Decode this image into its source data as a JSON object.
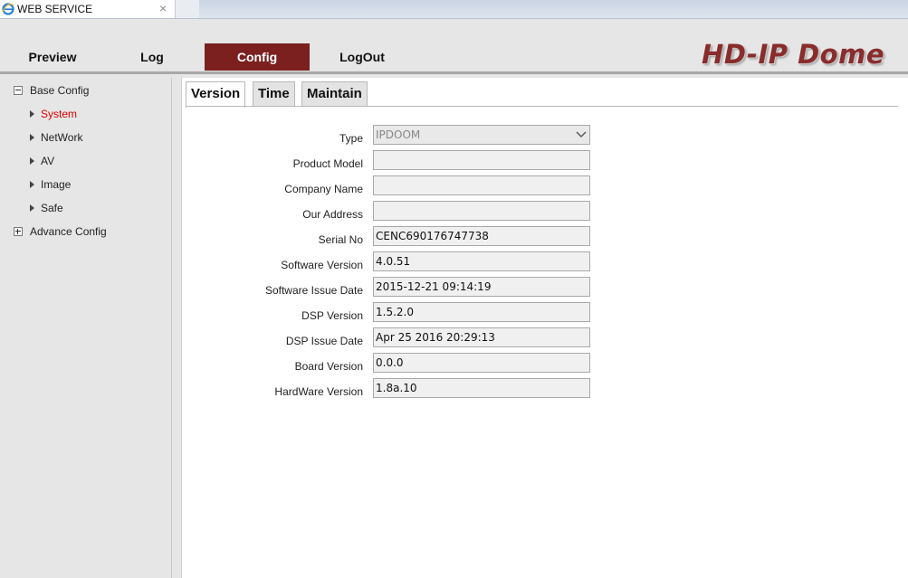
{
  "browser": {
    "tab_title": "WEB SERVICE",
    "close_symbol": "×",
    "icon": "ie-icon"
  },
  "header": {
    "nav": [
      "Preview",
      "Log",
      "Config",
      "LogOut"
    ],
    "active_nav": "Config",
    "brand": "HD-IP Dome",
    "colors": {
      "active_nav_bg": "#7b1f1f",
      "brand": "#8a2c2c"
    }
  },
  "sidebar": {
    "groups": [
      {
        "label": "Base Config",
        "expanded": true,
        "toggle": "−"
      },
      {
        "label": "Advance Config",
        "expanded": false,
        "toggle": "+"
      }
    ],
    "items": [
      {
        "label": "System",
        "active": true
      },
      {
        "label": "NetWork",
        "active": false
      },
      {
        "label": "AV",
        "active": false
      },
      {
        "label": "Image",
        "active": false
      },
      {
        "label": "Safe",
        "active": false
      }
    ],
    "active_color": "#e00000"
  },
  "tabs": [
    "Version",
    "Time",
    "Maintain"
  ],
  "active_tab": "Version",
  "fields": [
    {
      "label": "Type",
      "value": "IPDOOM",
      "kind": "select"
    },
    {
      "label": "Product Model",
      "value": ""
    },
    {
      "label": "Company Name",
      "value": ""
    },
    {
      "label": "Our Address",
      "value": ""
    },
    {
      "label": "Serial No",
      "value": "CENC690176747738"
    },
    {
      "label": "Software Version",
      "value": "4.0.51"
    },
    {
      "label": "Software Issue Date",
      "value": "2015-12-21 09:14:19"
    },
    {
      "label": "DSP Version",
      "value": "1.5.2.0"
    },
    {
      "label": "DSP Issue Date",
      "value": "Apr 25 2016 20:29:13"
    },
    {
      "label": "Board Version",
      "value": "0.0.0"
    },
    {
      "label": "HardWare Version",
      "value": "1.8a.10"
    }
  ]
}
